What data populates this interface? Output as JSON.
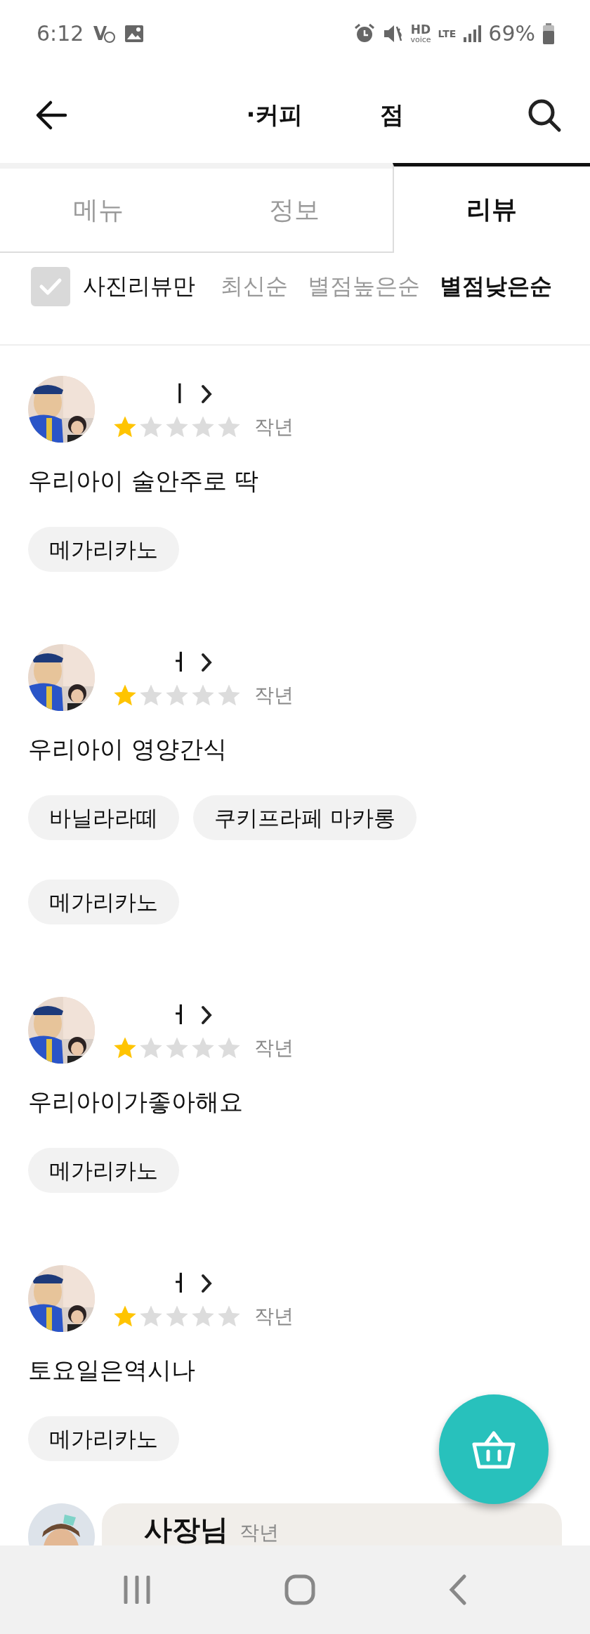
{
  "status_bar": {
    "time": "6:12",
    "hd": "HD",
    "voice": "voice",
    "lte": "LTE",
    "battery": "69%"
  },
  "header": {
    "title_parts": [
      "·커피",
      "점"
    ]
  },
  "tabs": [
    {
      "label": "메뉴",
      "selected": false
    },
    {
      "label": "정보",
      "selected": false
    },
    {
      "label": "리뷰",
      "selected": true
    }
  ],
  "filter": {
    "photo_only": {
      "label": "사진리뷰만",
      "checked": true
    },
    "sorts": [
      {
        "label": "최신순",
        "selected": false
      },
      {
        "label": "별점높은순",
        "selected": false
      },
      {
        "label": "별점낮은순",
        "selected": true
      }
    ]
  },
  "reviews": [
    {
      "name": "ㅣ",
      "stars": 1,
      "date": "작년",
      "text": "우리아이 술안주로 딱",
      "tags": [
        "메가리카노"
      ]
    },
    {
      "name": "ㅓ",
      "stars": 1,
      "date": "작년",
      "text": "우리아이 영양간식",
      "tags": [
        "바닐라라떼",
        "쿠키프라페 마카롱",
        "메가리카노"
      ]
    },
    {
      "name": "ㅓ",
      "stars": 1,
      "date": "작년",
      "text": "우리아이가좋아해요",
      "tags": [
        "메가리카노"
      ]
    },
    {
      "name": "ㅓ",
      "stars": 1,
      "date": "작년",
      "text": "토요일은역시나",
      "tags": [
        "메가리카노"
      ]
    }
  ],
  "owner_reply": {
    "name": "사장님",
    "date": "작년"
  }
}
